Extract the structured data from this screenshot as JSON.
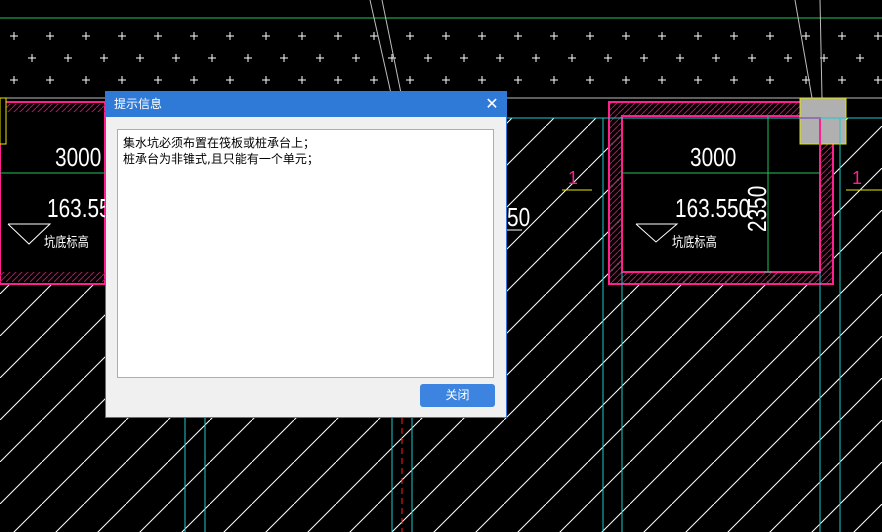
{
  "dialog": {
    "title": "提示信息",
    "close_glyph": "✕",
    "messages": [
      "集水坑必须布置在筏板或桩承台上；",
      "桩承台为非锥式,且只能有一个单元；"
    ],
    "close_button_label": "关闭"
  },
  "drawing": {
    "left_pit": {
      "width_label": "3000",
      "elevation_label": "163.55",
      "note": "坑底标高"
    },
    "right_pit": {
      "width_label": "3000",
      "elevation_label": "163.550",
      "depth_label": "2350",
      "note": "坑底标高"
    },
    "partial_label": "50",
    "section_marks": [
      "1",
      "1"
    ],
    "colors": {
      "hatch": "#ffffff",
      "pit_outline": "#ff1f8f",
      "cyan_lines": "#22c8c8",
      "green_lines": "#22c35a",
      "column": "#b0b0b0",
      "column_outline": "#e6e600"
    }
  }
}
